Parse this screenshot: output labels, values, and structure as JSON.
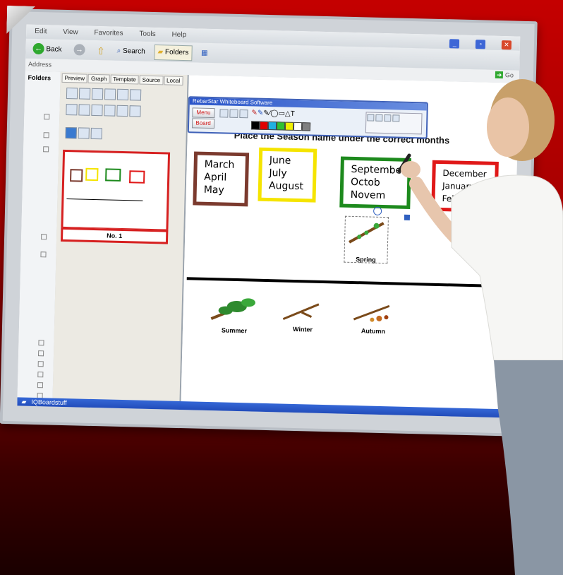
{
  "window": {
    "menu_items": [
      "Edit",
      "View",
      "Favorites",
      "Tools",
      "Help"
    ],
    "toolbar": {
      "back_label": "Back",
      "search_label": "Search",
      "folders_label": "Folders"
    },
    "address_label": "Address",
    "go_label": "Go",
    "folders_label": "Folders",
    "taskbar_label": "IQBoardstuff"
  },
  "panel": {
    "tabs": [
      "Preview",
      "Graph",
      "Template",
      "Source",
      "Local"
    ],
    "page_label": "No. 1"
  },
  "software_bar": {
    "title": "RebarStar Whiteboard Software",
    "menu_button": "Menu",
    "board_button": "Board",
    "colors": [
      "#000000",
      "#e00000",
      "#20b0e0",
      "#30c030",
      "#f0f000",
      "#ffffff",
      "#808080"
    ]
  },
  "lesson": {
    "heading": "Place the Season name under the correct months",
    "month_boxes": [
      {
        "months": [
          "March",
          "April",
          "May"
        ],
        "border_color": "#7b3a2e"
      },
      {
        "months": [
          "June",
          "July",
          "August"
        ],
        "border_color": "#f5e400"
      },
      {
        "months": [
          "September",
          "Octob",
          "Novem"
        ],
        "border_color": "#1d8a1d"
      },
      {
        "months": [
          "December",
          "January",
          "February"
        ],
        "border_color": "#e01818"
      }
    ],
    "season_labels": [
      "Spring",
      "Summer",
      "Winter",
      "Autumn"
    ]
  }
}
